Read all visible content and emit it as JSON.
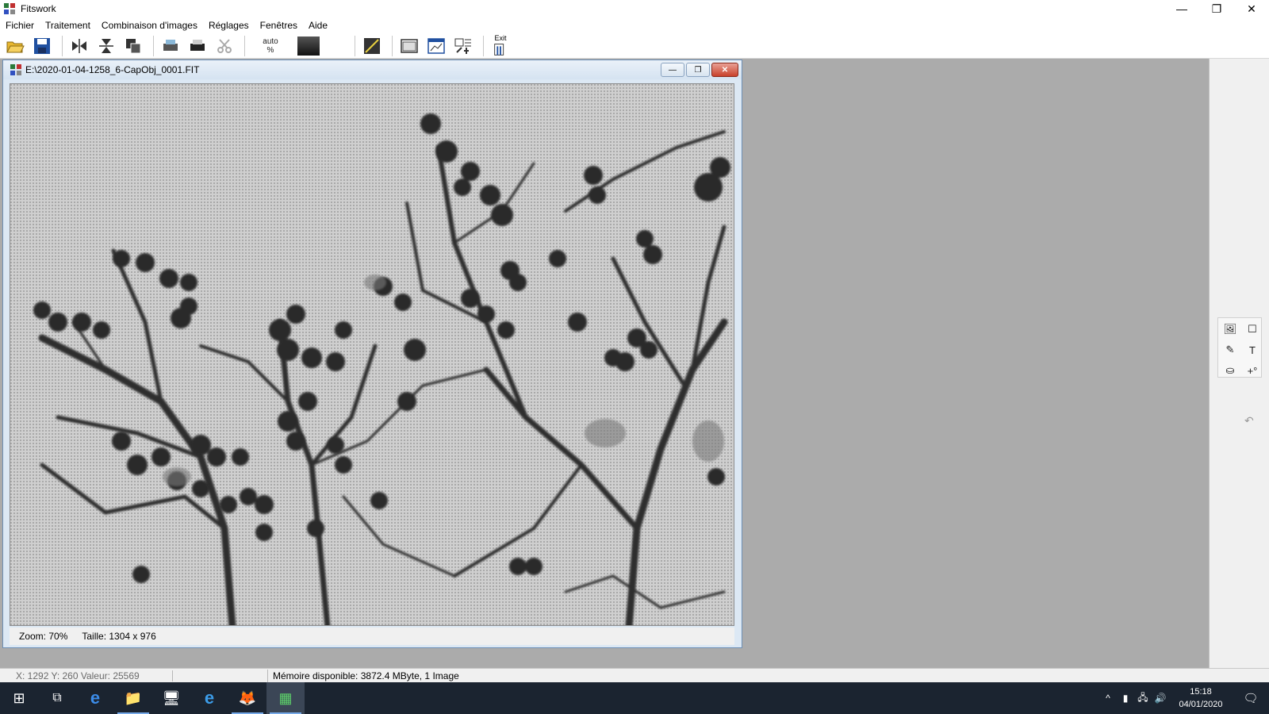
{
  "app": {
    "title": "Fitswork",
    "window_controls": {
      "minimize": "—",
      "maximize": "❐",
      "close": "✕"
    }
  },
  "menubar": {
    "items": [
      "Fichier",
      "Traitement",
      "Combinaison d'images",
      "Réglages",
      "Fenêtres",
      "Aide"
    ]
  },
  "toolbar": {
    "buttons": [
      "open-icon",
      "save-icon",
      "flip-horizontal-icon",
      "flip-vertical-icon",
      "rotate-icon",
      "print-icon",
      "printer-icon",
      "scissors-icon",
      "histogram-icon",
      "window-icon",
      "curve-window-icon",
      "image-tools-icon",
      "exit-icon"
    ],
    "auto_label_top": "auto",
    "auto_label_bottom": "%",
    "exit_label": "Exit"
  },
  "child_window": {
    "title": "E:\\2020-01-04-1258_6-CapObj_0001.FIT",
    "zoom_text": "Zoom: 70%",
    "size_text": "Taille: 1304 x 976",
    "controls": {
      "minimize": "—",
      "restore": "❐",
      "close": "✕"
    }
  },
  "right_panel": {
    "tools": [
      "image-overlay-icon",
      "rectangle-select-icon",
      "pipette-icon",
      "text-tool-icon",
      "stamp-icon",
      "point-add-icon"
    ],
    "tool_glyphs": [
      "🖼",
      "☐",
      "✎",
      "T",
      "⛀",
      "+°"
    ],
    "undo_glyph": "↶"
  },
  "statusbar": {
    "coords": "X: 1292  Y: 260  Valeur: 25569",
    "memory": "Mémoire disponible: 3872.4 MByte, 1 Image"
  },
  "taskbar": {
    "items": [
      "start-icon",
      "task-view-icon",
      "edge-icon",
      "file-explorer-icon",
      "control-panel-icon",
      "internet-explorer-icon",
      "firefox-icon",
      "fitswork-icon"
    ],
    "glyphs": [
      "⊞",
      "⧉",
      "e",
      "📁",
      "🖥",
      "e",
      "🦊",
      "▦"
    ],
    "tray_glyphs": [
      "^",
      "▮",
      "🖧",
      "🔊"
    ],
    "time": "15:18",
    "date": "04/01/2020",
    "notification_glyph": "🗨"
  }
}
